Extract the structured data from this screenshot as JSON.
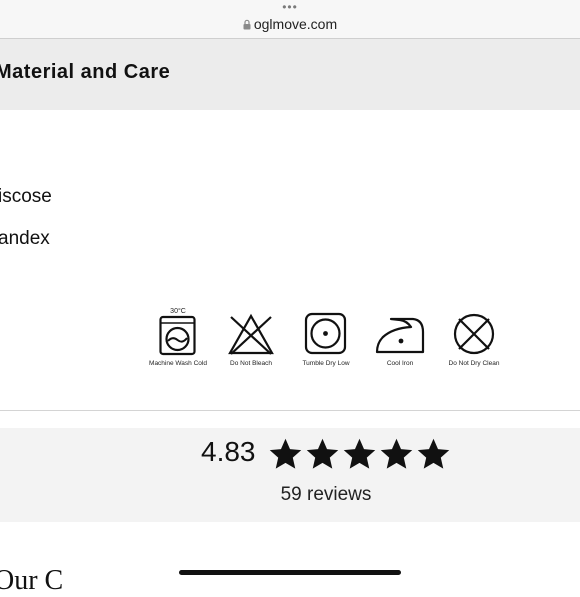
{
  "browser": {
    "menu_dots": "•••",
    "url": "oglmove.com"
  },
  "section": {
    "title": "Material and Care"
  },
  "composition": [
    "iscose",
    "andex"
  ],
  "care": {
    "temperature": "30°C",
    "items": [
      {
        "label": "Machine Wash Cold",
        "icon": "machine-wash-cold-icon"
      },
      {
        "label": "Do Not Bleach",
        "icon": "do-not-bleach-icon"
      },
      {
        "label": "Tumble Dry Low",
        "icon": "tumble-dry-low-icon"
      },
      {
        "label": "Cool Iron",
        "icon": "cool-iron-icon"
      },
      {
        "label": "Do Not Dry Clean",
        "icon": "do-not-dry-clean-icon"
      }
    ]
  },
  "reviews": {
    "rating": "4.83",
    "stars_filled": 5,
    "stars_total": 5,
    "count_text": "59 reviews"
  },
  "next_section": {
    "heading_partial": "Our C"
  }
}
